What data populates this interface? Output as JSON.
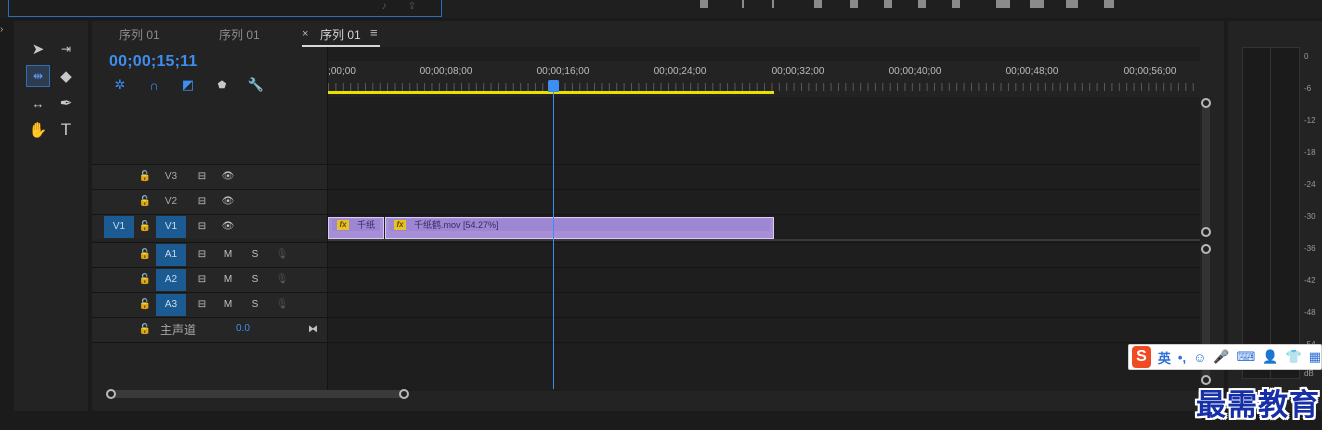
{
  "tabs": [
    {
      "label": "序列 01"
    },
    {
      "label": "序列 01"
    },
    {
      "label": "序列 01",
      "active": true
    }
  ],
  "tab_close": "×",
  "tab_menu": "≡",
  "timecode": "00;00;15;11",
  "ruler_labels": [
    ";00;00",
    "00;00;08;00",
    "00;00;16;00",
    "00;00;24;00",
    "00;00;32;00",
    "00;00;40;00",
    "00;00;48;00",
    "00;00;56;00"
  ],
  "tracks": {
    "video": [
      {
        "source": "",
        "target": "V3",
        "targeted": false
      },
      {
        "source": "",
        "target": "V2",
        "targeted": false
      },
      {
        "source": "V1",
        "target": "V1",
        "targeted": true
      }
    ],
    "audio": [
      {
        "target": "A1",
        "mute": "M",
        "solo": "S"
      },
      {
        "target": "A2",
        "mute": "M",
        "solo": "S"
      },
      {
        "target": "A3",
        "mute": "M",
        "solo": "S"
      }
    ],
    "master": {
      "label": "主声道",
      "value": "0.0"
    }
  },
  "clips": [
    {
      "name": "千纸",
      "fx": "fx"
    },
    {
      "name": "千纸鹤.mov [54.27%]",
      "fx": "fx"
    }
  ],
  "meter_ticks": [
    "0",
    "-6",
    "-12",
    "-18",
    "-24",
    "-30",
    "-36",
    "-42",
    "-48",
    "-54",
    "dB"
  ],
  "ime": {
    "logo": "S",
    "lang": "英",
    "punct": "•,",
    "items": [
      "☺",
      "🎤",
      "⌨",
      "👤",
      "👕",
      "▦"
    ]
  },
  "watermark": "最需教育",
  "colors": {
    "accent": "#3d8ef0",
    "clip": "#a78fd8",
    "work_area": "#e8e000",
    "target": "#1c5a92"
  }
}
